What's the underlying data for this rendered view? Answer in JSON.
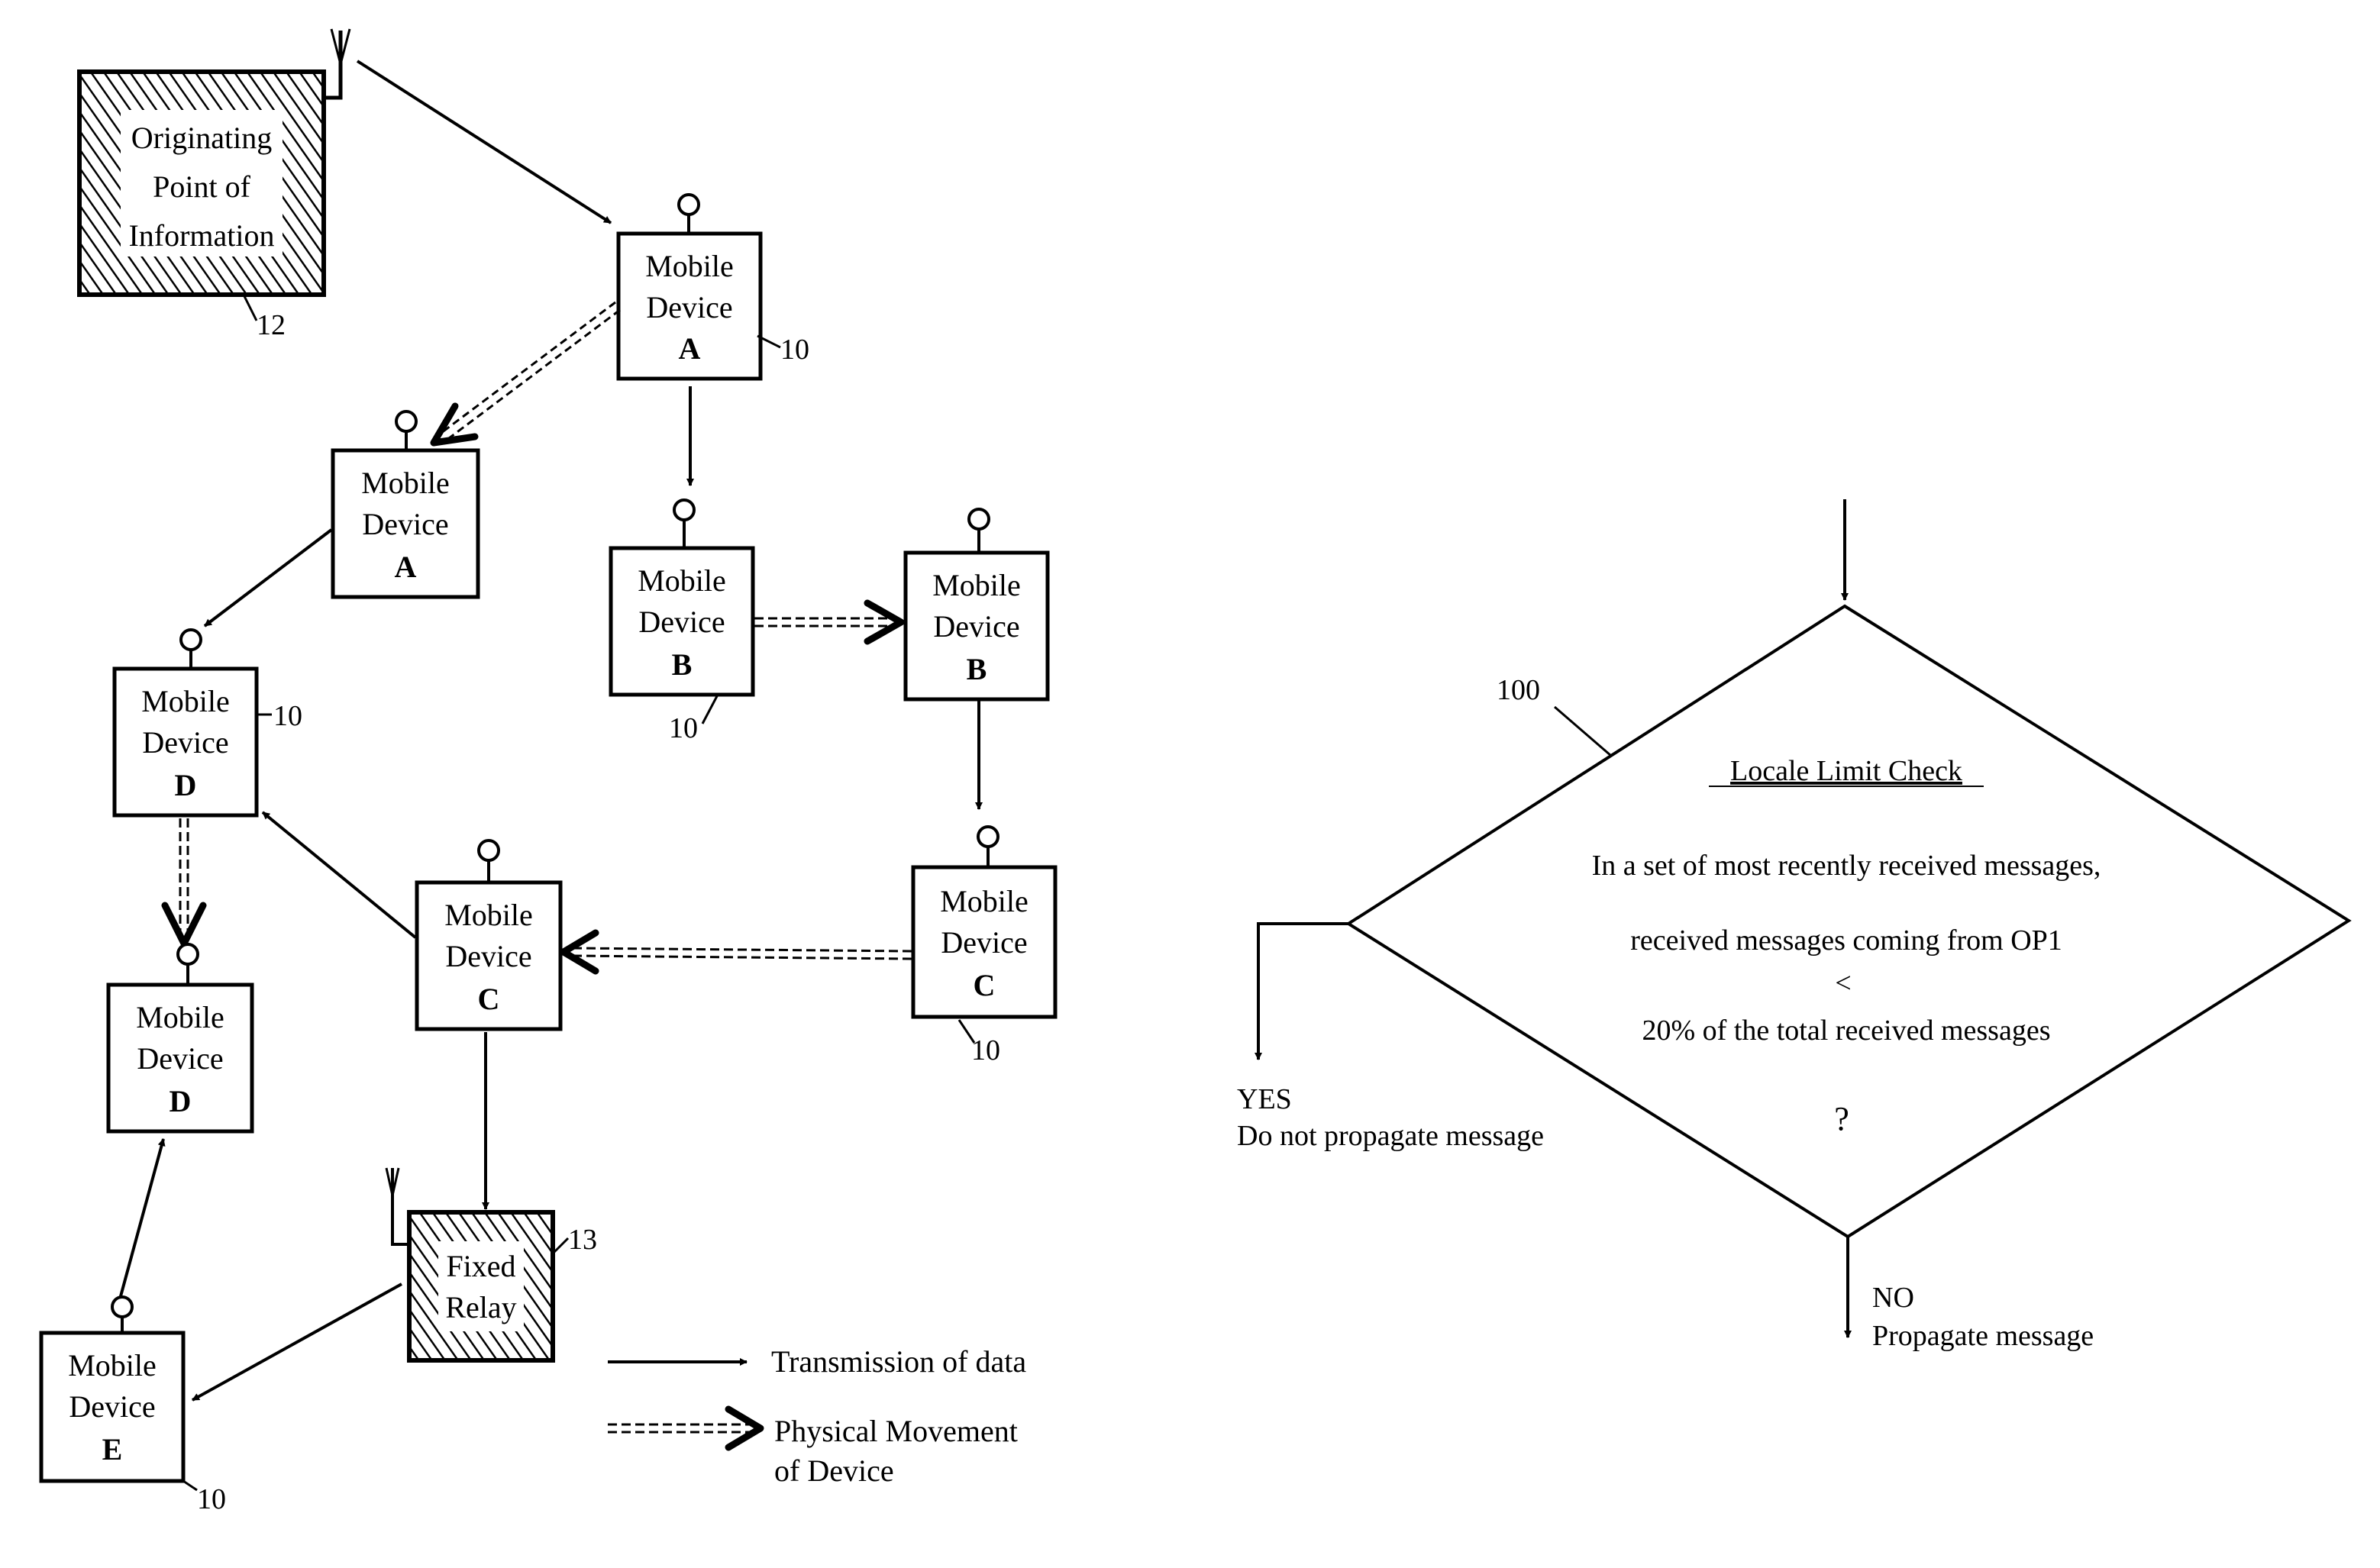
{
  "figure": {
    "nodes": {
      "origin": {
        "lines": [
          "Originating",
          "Point of",
          "Information"
        ],
        "ref": "12"
      },
      "device_a1": {
        "line1": "Mobile",
        "line2": "Device",
        "letter": "A",
        "ref": "10"
      },
      "device_a2": {
        "line1": "Mobile",
        "line2": "Device",
        "letter": "A"
      },
      "device_b1": {
        "line1": "Mobile",
        "line2": "Device",
        "letter": "B",
        "ref": "10"
      },
      "device_b2": {
        "line1": "Mobile",
        "line2": "Device",
        "letter": "B"
      },
      "device_c2": {
        "line1": "Mobile",
        "line2": "Device",
        "letter": "C",
        "ref": "10"
      },
      "device_c1": {
        "line1": "Mobile",
        "line2": "Device",
        "letter": "C"
      },
      "device_d1": {
        "line1": "Mobile",
        "line2": "Device",
        "letter": "D",
        "ref": "10"
      },
      "device_d2": {
        "line1": "Mobile",
        "line2": "Device",
        "letter": "D"
      },
      "device_e": {
        "line1": "Mobile",
        "line2": "Device",
        "letter": "E",
        "ref": "10"
      },
      "relay": {
        "lines": [
          "Fixed",
          "Relay"
        ],
        "ref": "13"
      }
    },
    "legend": {
      "transmission": "Transmission of data",
      "movement_line1": "Physical Movement",
      "movement_line2": "of Device"
    }
  },
  "flowchart": {
    "ref": "100",
    "title": "Locale Limit Check",
    "condition": [
      "In a set of most recently received messages,",
      "received messages coming from OP1",
      "<",
      "20% of the total received messages",
      "?"
    ],
    "yes": {
      "label": "YES",
      "action": "Do not propagate message"
    },
    "no": {
      "label": "NO",
      "action": "Propagate message"
    }
  }
}
